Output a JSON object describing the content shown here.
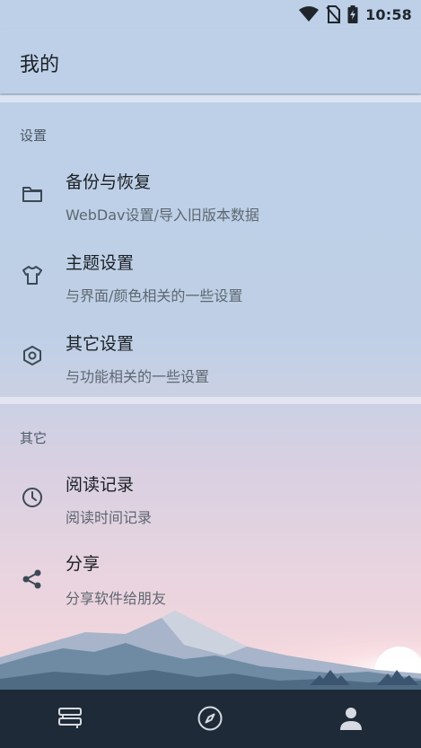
{
  "status_bar": {
    "time": "10:58",
    "icons": [
      "wifi-icon",
      "no-sim-icon",
      "battery-charging-icon"
    ]
  },
  "header": {
    "title": "我的"
  },
  "sections": [
    {
      "title": "设置",
      "items": [
        {
          "icon": "folder-icon",
          "title": "备份与恢复",
          "subtitle": "WebDav设置/导入旧版本数据"
        },
        {
          "icon": "tshirt-icon",
          "title": "主题设置",
          "subtitle": "与界面/颜色相关的一些设置"
        },
        {
          "icon": "hexagon-settings-icon",
          "title": "其它设置",
          "subtitle": "与功能相关的一些设置"
        }
      ]
    },
    {
      "title": "其它",
      "items": [
        {
          "icon": "clock-icon",
          "title": "阅读记录",
          "subtitle": "阅读时间记录"
        },
        {
          "icon": "share-icon",
          "title": "分享",
          "subtitle": "分享软件给朋友"
        }
      ]
    }
  ],
  "bottom_nav": {
    "items": [
      {
        "icon": "bookshelf-icon",
        "selected": false
      },
      {
        "icon": "compass-icon",
        "selected": false
      },
      {
        "icon": "person-icon",
        "selected": true
      }
    ]
  },
  "colors": {
    "background_top": "#bdd0e8",
    "background_bottom": "#f5dce0",
    "bottom_nav_bg": "#1e2a38",
    "nav_icon": "#d7dbe1",
    "accent_icon": "#3b4956"
  }
}
